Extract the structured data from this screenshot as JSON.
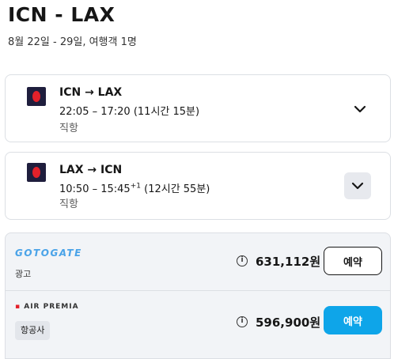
{
  "header": {
    "route": "ICN - LAX",
    "meta": "8월 22일 - 29일, 여행객 1명"
  },
  "legs": [
    {
      "route": "ICN → LAX",
      "time": "22:05 – 17:20",
      "day_offset": "",
      "duration": "(11시간 15분)",
      "stops": "직항"
    },
    {
      "route": "LAX → ICN",
      "time": "10:50 – 15:45",
      "day_offset": "+1",
      "duration": "(12시간 55분)",
      "stops": "직항"
    }
  ],
  "offers": [
    {
      "provider": "GOTOGATE",
      "tag": "광고",
      "info": "i",
      "price": "631,112원",
      "button": "예약"
    },
    {
      "provider_prefix": "AIR PREMI",
      "provider_suffix": "A",
      "tag": "항공사",
      "info": "i",
      "price": "596,900원",
      "button": "예약"
    }
  ],
  "colors": {
    "airline_logo_bg": "#1f1e3d",
    "airline_logo_mark": "#e3212a",
    "primary_button": "#0ea5e9",
    "gotogate_brand": "#4aa3e8"
  }
}
